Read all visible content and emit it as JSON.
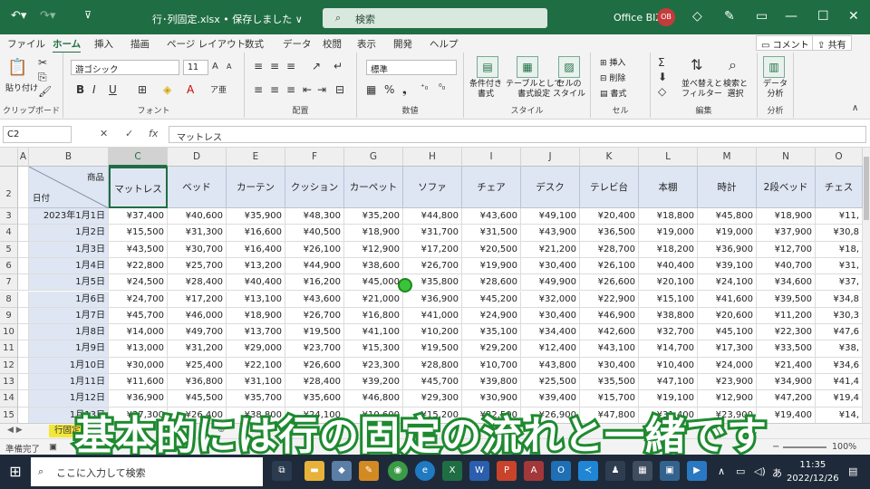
{
  "titlebar": {
    "autosave_icon": "undo-icon",
    "filename": "行･列固定.xlsx • 保存しました ∨",
    "search_placeholder": "検索",
    "user": "Office BIZ",
    "avatar": "OB"
  },
  "menu": {
    "tabs": [
      "ファイル",
      "ホーム",
      "挿入",
      "描画",
      "ページ レイアウト",
      "数式",
      "データ",
      "校閲",
      "表示",
      "開発",
      "ヘルプ"
    ],
    "active": "ホーム",
    "comment_btn": "コメント",
    "share_btn": "共有"
  },
  "ribbon": {
    "clipboard": {
      "paste": "貼り付け",
      "label": "クリップボード"
    },
    "font": {
      "name": "游ゴシック",
      "size": "11",
      "label": "フォント"
    },
    "alignment": {
      "label": "配置"
    },
    "number": {
      "format": "標準",
      "label": "数値"
    },
    "styles": {
      "cond": "条件付き\n書式",
      "table": "テーブルとして\n書式設定",
      "cell": "セルの\nスタイル",
      "label": "スタイル"
    },
    "cells": {
      "insert": "挿入",
      "delete": "削除",
      "format": "書式",
      "label": "セル"
    },
    "editing": {
      "sort": "並べ替えと\nフィルター",
      "find": "検索と\n選択",
      "label": "編集"
    },
    "analysis": {
      "data": "データ\n分析",
      "label": "分析"
    }
  },
  "formula_bar": {
    "namebox": "C2",
    "value": "マットレス"
  },
  "sheet": {
    "columns": [
      "A",
      "B",
      "C",
      "D",
      "E",
      "F",
      "G",
      "H",
      "I",
      "J",
      "K",
      "L",
      "M",
      "N",
      "O"
    ],
    "selected_column": "C",
    "header_row": "2",
    "header_corner_top": "商品",
    "header_corner_bottom": "日付",
    "headers": [
      "マットレス",
      "ベッド",
      "カーテン",
      "クッション",
      "カーペット",
      "ソファ",
      "チェア",
      "デスク",
      "テレビ台",
      "本棚",
      "時計",
      "2段ベッド",
      "チェス"
    ],
    "rows": [
      {
        "num": "3",
        "date": "2023年1月1日",
        "values": [
          "¥37,400",
          "¥40,600",
          "¥35,900",
          "¥48,300",
          "¥35,200",
          "¥44,800",
          "¥43,600",
          "¥49,100",
          "¥20,400",
          "¥18,800",
          "¥45,800",
          "¥18,900",
          "¥11,"
        ]
      },
      {
        "num": "4",
        "date": "1月2日",
        "values": [
          "¥15,500",
          "¥31,300",
          "¥16,600",
          "¥40,500",
          "¥18,900",
          "¥31,700",
          "¥31,500",
          "¥43,900",
          "¥36,500",
          "¥19,000",
          "¥19,000",
          "¥37,900",
          "¥30,8"
        ]
      },
      {
        "num": "5",
        "date": "1月3日",
        "values": [
          "¥43,500",
          "¥30,700",
          "¥16,400",
          "¥26,100",
          "¥12,900",
          "¥17,200",
          "¥20,500",
          "¥21,200",
          "¥28,700",
          "¥18,200",
          "¥36,900",
          "¥12,700",
          "¥18,"
        ]
      },
      {
        "num": "6",
        "date": "1月4日",
        "values": [
          "¥22,800",
          "¥25,700",
          "¥13,200",
          "¥44,900",
          "¥38,600",
          "¥26,700",
          "¥19,900",
          "¥30,400",
          "¥26,100",
          "¥40,400",
          "¥39,100",
          "¥40,700",
          "¥31,"
        ]
      },
      {
        "num": "7",
        "date": "1月5日",
        "values": [
          "¥24,500",
          "¥28,400",
          "¥40,400",
          "¥16,200",
          "¥45,000",
          "¥35,800",
          "¥28,600",
          "¥49,900",
          "¥26,600",
          "¥20,100",
          "¥24,100",
          "¥34,600",
          "¥37,"
        ]
      },
      {
        "num": "8",
        "date": "1月6日",
        "values": [
          "¥24,700",
          "¥17,200",
          "¥13,100",
          "¥43,600",
          "¥21,000",
          "¥36,900",
          "¥45,200",
          "¥32,000",
          "¥22,900",
          "¥15,100",
          "¥41,600",
          "¥39,500",
          "¥34,8"
        ]
      },
      {
        "num": "9",
        "date": "1月7日",
        "values": [
          "¥45,700",
          "¥46,000",
          "¥18,900",
          "¥26,700",
          "¥16,800",
          "¥41,000",
          "¥24,900",
          "¥30,400",
          "¥46,900",
          "¥38,800",
          "¥20,600",
          "¥11,200",
          "¥30,3"
        ]
      },
      {
        "num": "10",
        "date": "1月8日",
        "values": [
          "¥14,000",
          "¥49,700",
          "¥13,700",
          "¥19,500",
          "¥41,100",
          "¥10,200",
          "¥35,100",
          "¥34,400",
          "¥42,600",
          "¥32,700",
          "¥45,100",
          "¥22,300",
          "¥47,6"
        ]
      },
      {
        "num": "11",
        "date": "1月9日",
        "values": [
          "¥13,000",
          "¥31,200",
          "¥29,000",
          "¥23,700",
          "¥15,300",
          "¥19,500",
          "¥29,200",
          "¥12,400",
          "¥43,100",
          "¥14,700",
          "¥17,300",
          "¥33,500",
          "¥38,"
        ]
      },
      {
        "num": "12",
        "date": "1月10日",
        "values": [
          "¥30,000",
          "¥25,400",
          "¥22,100",
          "¥26,600",
          "¥23,300",
          "¥28,800",
          "¥10,700",
          "¥43,800",
          "¥30,400",
          "¥10,400",
          "¥24,000",
          "¥21,400",
          "¥34,6"
        ]
      },
      {
        "num": "13",
        "date": "1月11日",
        "values": [
          "¥11,600",
          "¥36,800",
          "¥31,100",
          "¥28,400",
          "¥39,200",
          "¥45,700",
          "¥39,800",
          "¥25,500",
          "¥35,500",
          "¥47,100",
          "¥23,900",
          "¥34,900",
          "¥41,4"
        ]
      },
      {
        "num": "14",
        "date": "1月12日",
        "values": [
          "¥36,900",
          "¥45,500",
          "¥35,700",
          "¥35,600",
          "¥46,800",
          "¥29,300",
          "¥30,900",
          "¥39,400",
          "¥15,700",
          "¥19,100",
          "¥12,900",
          "¥47,200",
          "¥19,4"
        ]
      },
      {
        "num": "15",
        "date": "1月13日",
        "values": [
          "¥37,300",
          "¥26,400",
          "¥38,800",
          "¥24,100",
          "¥10,600",
          "¥15,200",
          "¥22,500",
          "¥26,900",
          "¥47,800",
          "¥31,400",
          "¥23,900",
          "¥19,400",
          "¥14,"
        ]
      }
    ],
    "tab_name": "行固定"
  },
  "status": {
    "ready": "準備完了",
    "zoom": "100%"
  },
  "caption": "基本的には行の固定の流れと一緒です",
  "taskbar": {
    "search_placeholder": "ここに入力して検索",
    "time": "11:35",
    "date": "2022/12/26",
    "ime": "あ"
  }
}
